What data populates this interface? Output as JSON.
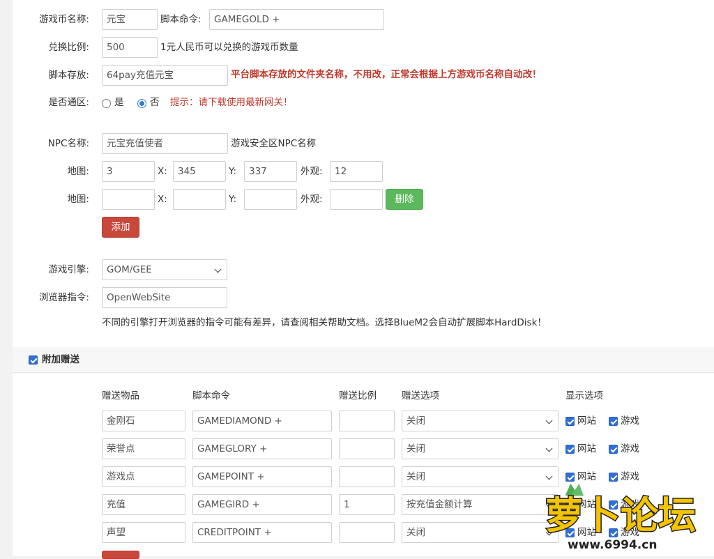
{
  "form": {
    "currency_name": {
      "label": "游戏币名称:",
      "value": "元宝"
    },
    "script_cmd": {
      "label": "脚本命令:",
      "value": "GAMEGOLD +"
    },
    "exchange_rate": {
      "label": "兑换比例:",
      "value": "500",
      "hint": "1元人民币可以兑换的游戏币数量"
    },
    "script_folder": {
      "label": "脚本存放:",
      "value": "64pay充值元宝",
      "warning": "平台脚本存放的文件夹名称，不用改，正常会根据上方游戏币名称自动改！"
    },
    "universal_zone": {
      "label": "是否通区:",
      "option_yes": "是",
      "option_no": "否",
      "selected": "否",
      "tip": "提示：请下载使用最新网关！"
    },
    "npc_name": {
      "label": "NPC名称:",
      "value": "元宝充值使者",
      "hint": "游戏安全区NPC名称"
    },
    "maps": {
      "map_label": "地图:",
      "x_label": "X:",
      "y_label": "Y:",
      "look_label": "外观:",
      "rows": [
        {
          "map": "3",
          "x": "345",
          "y": "337",
          "look": "12"
        },
        {
          "map": "",
          "x": "",
          "y": "",
          "look": ""
        }
      ],
      "delete_label": "删除",
      "add_label": "添加"
    },
    "engine": {
      "label": "游戏引擎:",
      "value": "GOM/GEE"
    },
    "browser_cmd": {
      "label": "浏览器指令:",
      "value": "OpenWebSite",
      "note": "不同的引擎打开浏览器的指令可能有差异，请查阅相关帮助文档。选择BlueM2会自动扩展脚本HardDisk！"
    }
  },
  "bonus": {
    "title": "附加赠送",
    "checked": true,
    "headers": {
      "item": "赠送物品",
      "script": "脚本命令",
      "ratio": "赠送比例",
      "option": "赠送选项",
      "display": "显示选项"
    },
    "display_site": "网站",
    "display_game": "游戏",
    "rows": [
      {
        "item": "金刚石",
        "script": "GAMEDIAMOND +",
        "ratio": "",
        "option": "关闭"
      },
      {
        "item": "荣誉点",
        "script": "GAMEGLORY +",
        "ratio": "",
        "option": "关闭"
      },
      {
        "item": "游戏点",
        "script": "GAMEPOINT +",
        "ratio": "",
        "option": "关闭"
      },
      {
        "item": "充值",
        "script": "GAMEGIRD +",
        "ratio": "1",
        "option": "按充值金额计算"
      },
      {
        "item": "声望",
        "script": "CREDITPOINT +",
        "ratio": "",
        "option": "关闭"
      }
    ]
  },
  "watermark": {
    "brand": "萝卜论坛",
    "site": "www.6994.cn"
  }
}
